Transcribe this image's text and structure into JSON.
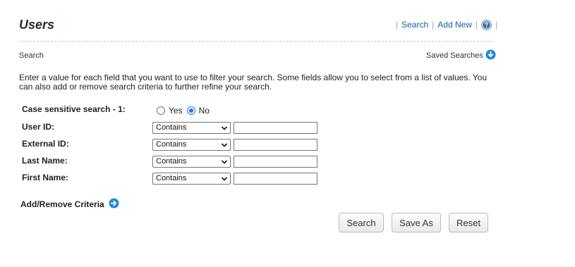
{
  "header": {
    "title": "Users",
    "links": {
      "search": "Search",
      "add_new": "Add New"
    },
    "separator": "|",
    "help_icon": "question-circle-icon"
  },
  "section": {
    "label": "Search",
    "saved_searches": "Saved Searches",
    "saved_searches_icon": "arrow-down-circle-icon"
  },
  "intro": "Enter a value for each field that you want to use to filter your search. Some fields allow you to select from a list of values. You can also add or remove search criteria to further refine your search.",
  "case_sensitive": {
    "label": "Case sensitive search - 1:",
    "options": [
      "Yes",
      "No"
    ],
    "selected": "No"
  },
  "criteria": [
    {
      "label": "User ID:",
      "operator": "Contains",
      "value": ""
    },
    {
      "label": "External ID:",
      "operator": "Contains",
      "value": ""
    },
    {
      "label": "Last Name:",
      "operator": "Contains",
      "value": ""
    },
    {
      "label": "First Name:",
      "operator": "Contains",
      "value": ""
    }
  ],
  "add_remove": {
    "label": "Add/Remove Criteria",
    "icon": "arrow-right-circle-icon"
  },
  "buttons": {
    "search": "Search",
    "save_as": "Save As",
    "reset": "Reset"
  },
  "colors": {
    "link": "#1a5fa8",
    "icon_blue": "#1e88d8",
    "radio_checked": "#1a73e8"
  }
}
